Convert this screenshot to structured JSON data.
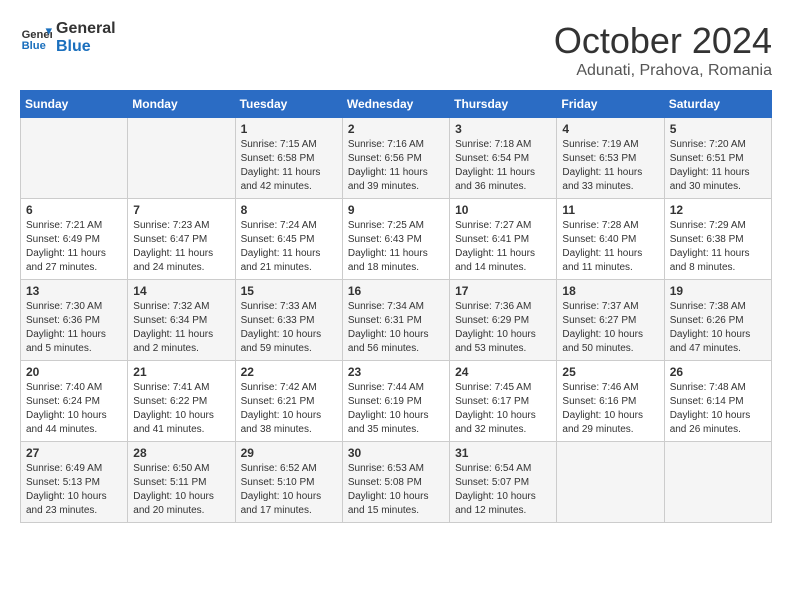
{
  "header": {
    "logo_line1": "General",
    "logo_line2": "Blue",
    "month": "October 2024",
    "location": "Adunati, Prahova, Romania"
  },
  "days_of_week": [
    "Sunday",
    "Monday",
    "Tuesday",
    "Wednesday",
    "Thursday",
    "Friday",
    "Saturday"
  ],
  "weeks": [
    [
      {
        "day": "",
        "info": ""
      },
      {
        "day": "",
        "info": ""
      },
      {
        "day": "1",
        "info": "Sunrise: 7:15 AM\nSunset: 6:58 PM\nDaylight: 11 hours and 42 minutes."
      },
      {
        "day": "2",
        "info": "Sunrise: 7:16 AM\nSunset: 6:56 PM\nDaylight: 11 hours and 39 minutes."
      },
      {
        "day": "3",
        "info": "Sunrise: 7:18 AM\nSunset: 6:54 PM\nDaylight: 11 hours and 36 minutes."
      },
      {
        "day": "4",
        "info": "Sunrise: 7:19 AM\nSunset: 6:53 PM\nDaylight: 11 hours and 33 minutes."
      },
      {
        "day": "5",
        "info": "Sunrise: 7:20 AM\nSunset: 6:51 PM\nDaylight: 11 hours and 30 minutes."
      }
    ],
    [
      {
        "day": "6",
        "info": "Sunrise: 7:21 AM\nSunset: 6:49 PM\nDaylight: 11 hours and 27 minutes."
      },
      {
        "day": "7",
        "info": "Sunrise: 7:23 AM\nSunset: 6:47 PM\nDaylight: 11 hours and 24 minutes."
      },
      {
        "day": "8",
        "info": "Sunrise: 7:24 AM\nSunset: 6:45 PM\nDaylight: 11 hours and 21 minutes."
      },
      {
        "day": "9",
        "info": "Sunrise: 7:25 AM\nSunset: 6:43 PM\nDaylight: 11 hours and 18 minutes."
      },
      {
        "day": "10",
        "info": "Sunrise: 7:27 AM\nSunset: 6:41 PM\nDaylight: 11 hours and 14 minutes."
      },
      {
        "day": "11",
        "info": "Sunrise: 7:28 AM\nSunset: 6:40 PM\nDaylight: 11 hours and 11 minutes."
      },
      {
        "day": "12",
        "info": "Sunrise: 7:29 AM\nSunset: 6:38 PM\nDaylight: 11 hours and 8 minutes."
      }
    ],
    [
      {
        "day": "13",
        "info": "Sunrise: 7:30 AM\nSunset: 6:36 PM\nDaylight: 11 hours and 5 minutes."
      },
      {
        "day": "14",
        "info": "Sunrise: 7:32 AM\nSunset: 6:34 PM\nDaylight: 11 hours and 2 minutes."
      },
      {
        "day": "15",
        "info": "Sunrise: 7:33 AM\nSunset: 6:33 PM\nDaylight: 10 hours and 59 minutes."
      },
      {
        "day": "16",
        "info": "Sunrise: 7:34 AM\nSunset: 6:31 PM\nDaylight: 10 hours and 56 minutes."
      },
      {
        "day": "17",
        "info": "Sunrise: 7:36 AM\nSunset: 6:29 PM\nDaylight: 10 hours and 53 minutes."
      },
      {
        "day": "18",
        "info": "Sunrise: 7:37 AM\nSunset: 6:27 PM\nDaylight: 10 hours and 50 minutes."
      },
      {
        "day": "19",
        "info": "Sunrise: 7:38 AM\nSunset: 6:26 PM\nDaylight: 10 hours and 47 minutes."
      }
    ],
    [
      {
        "day": "20",
        "info": "Sunrise: 7:40 AM\nSunset: 6:24 PM\nDaylight: 10 hours and 44 minutes."
      },
      {
        "day": "21",
        "info": "Sunrise: 7:41 AM\nSunset: 6:22 PM\nDaylight: 10 hours and 41 minutes."
      },
      {
        "day": "22",
        "info": "Sunrise: 7:42 AM\nSunset: 6:21 PM\nDaylight: 10 hours and 38 minutes."
      },
      {
        "day": "23",
        "info": "Sunrise: 7:44 AM\nSunset: 6:19 PM\nDaylight: 10 hours and 35 minutes."
      },
      {
        "day": "24",
        "info": "Sunrise: 7:45 AM\nSunset: 6:17 PM\nDaylight: 10 hours and 32 minutes."
      },
      {
        "day": "25",
        "info": "Sunrise: 7:46 AM\nSunset: 6:16 PM\nDaylight: 10 hours and 29 minutes."
      },
      {
        "day": "26",
        "info": "Sunrise: 7:48 AM\nSunset: 6:14 PM\nDaylight: 10 hours and 26 minutes."
      }
    ],
    [
      {
        "day": "27",
        "info": "Sunrise: 6:49 AM\nSunset: 5:13 PM\nDaylight: 10 hours and 23 minutes."
      },
      {
        "day": "28",
        "info": "Sunrise: 6:50 AM\nSunset: 5:11 PM\nDaylight: 10 hours and 20 minutes."
      },
      {
        "day": "29",
        "info": "Sunrise: 6:52 AM\nSunset: 5:10 PM\nDaylight: 10 hours and 17 minutes."
      },
      {
        "day": "30",
        "info": "Sunrise: 6:53 AM\nSunset: 5:08 PM\nDaylight: 10 hours and 15 minutes."
      },
      {
        "day": "31",
        "info": "Sunrise: 6:54 AM\nSunset: 5:07 PM\nDaylight: 10 hours and 12 minutes."
      },
      {
        "day": "",
        "info": ""
      },
      {
        "day": "",
        "info": ""
      }
    ]
  ]
}
